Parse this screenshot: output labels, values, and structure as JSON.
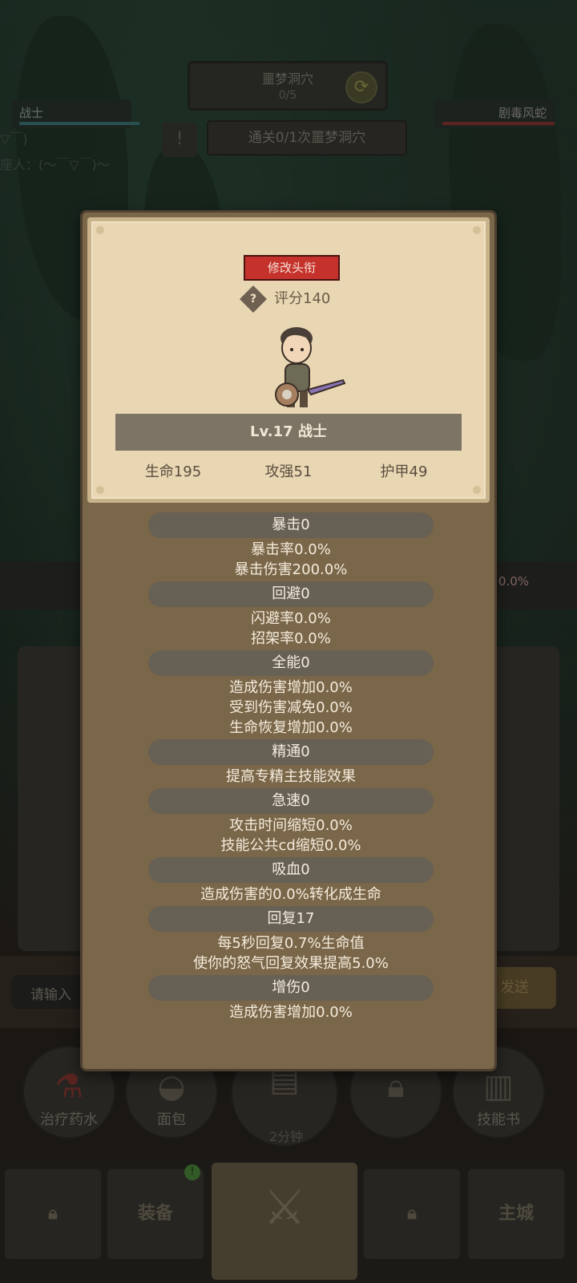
{
  "background": {
    "dungeon_name": "噩梦洞穴",
    "dungeon_progress": "0/5",
    "player_name": "战士",
    "enemy_name": "剧毒风蛇",
    "quest_text": "通关0/1次噩梦洞穴",
    "chat_lines": [
      "▽￣)",
      "座人：(～￣▽￣)～"
    ],
    "battle_percent": "0.0%",
    "chat_input_placeholder": "请输入",
    "send_label": "发送",
    "items": [
      {
        "label": "治疗药水",
        "icon": "potion-icon"
      },
      {
        "label": "面包",
        "icon": "bread-icon"
      },
      {
        "label": "",
        "icon": "chest-icon"
      },
      {
        "label": "",
        "icon": "lock-icon"
      },
      {
        "label": "技能书",
        "icon": "book-icon"
      }
    ],
    "timer": "2分钟",
    "tabs": [
      {
        "label": "",
        "icon": "lock-icon"
      },
      {
        "label": "装备",
        "icon": ""
      },
      {
        "label": "战斗",
        "icon": "crossed-swords-icon"
      },
      {
        "label": "",
        "icon": "lock-icon"
      },
      {
        "label": "主城",
        "icon": ""
      }
    ],
    "badge": "!"
  },
  "modal": {
    "title_button": "修改头衔",
    "score": "评分140",
    "help_glyph": "?",
    "level_label": "Lv.17 战士",
    "base_stats": [
      "生命195",
      "攻强51",
      "护甲49"
    ],
    "stats": [
      {
        "head": "暴击0",
        "lines": [
          "暴击率0.0%",
          "暴击伤害200.0%"
        ]
      },
      {
        "head": "回避0",
        "lines": [
          "闪避率0.0%",
          "招架率0.0%"
        ]
      },
      {
        "head": "全能0",
        "lines": [
          "造成伤害增加0.0%",
          "受到伤害减免0.0%",
          "生命恢复增加0.0%"
        ]
      },
      {
        "head": "精通0",
        "lines": [
          "提高专精主技能效果"
        ]
      },
      {
        "head": "急速0",
        "lines": [
          "攻击时间缩短0.0%",
          "技能公共cd缩短0.0%"
        ]
      },
      {
        "head": "吸血0",
        "lines": [
          "造成伤害的0.0%转化成生命"
        ]
      },
      {
        "head": "回复17",
        "lines": [
          "每5秒回复0.7%生命值",
          "使你的怒气回复效果提高5.0%"
        ]
      },
      {
        "head": "增伤0",
        "lines": [
          "造成伤害增加0.0%"
        ]
      }
    ]
  },
  "colors": {
    "modal_bg": "#7a6649",
    "card_bg": "#e9d6b2",
    "title_button": "#c5322c",
    "stat_pill": "#676054"
  }
}
